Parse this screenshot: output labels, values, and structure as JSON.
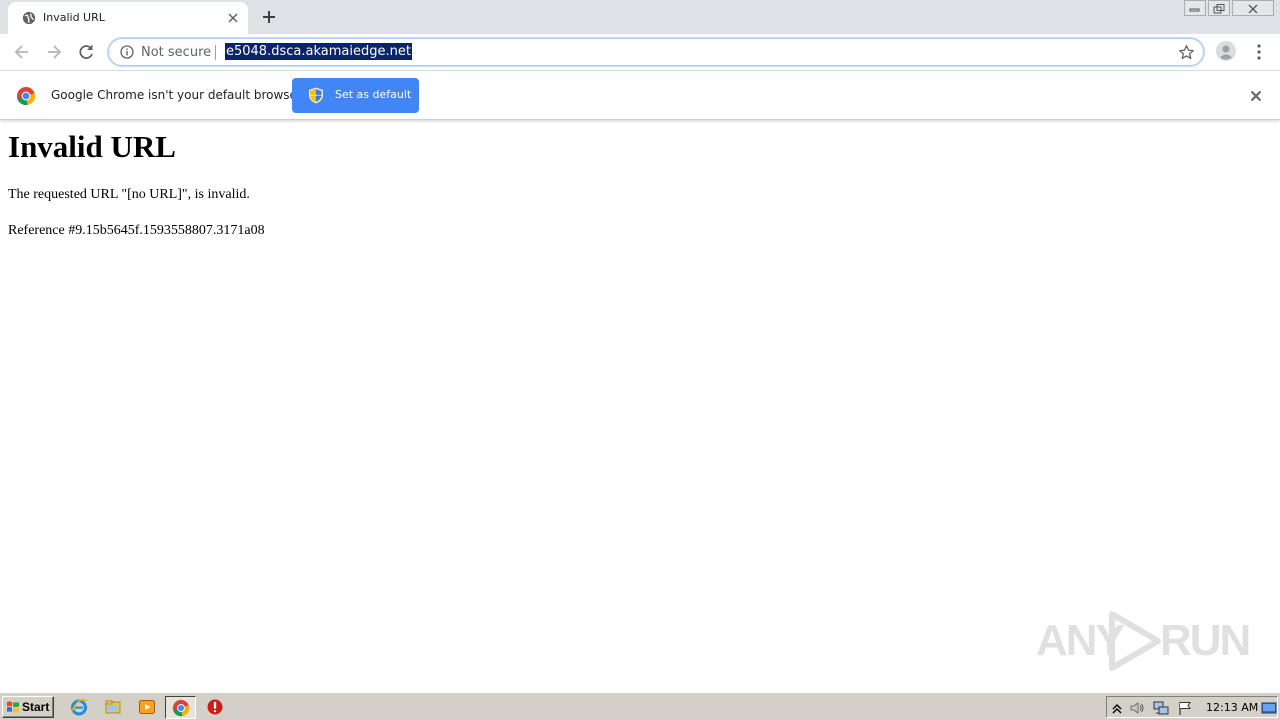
{
  "browser": {
    "tab": {
      "title": "Invalid URL",
      "favicon": "globe-icon",
      "close_icon": "close-icon"
    },
    "new_tab_icon": "plus-icon",
    "window_controls": [
      "minimize-icon",
      "restore-icon",
      "close-icon"
    ],
    "toolbar": {
      "back_icon": "arrow-left-icon",
      "forward_icon": "arrow-right-icon",
      "reload_icon": "reload-icon",
      "omnibox": {
        "security_label": "Not secure",
        "url": "e5048.dsca.akamaiedge.net",
        "url_selected": true
      },
      "bookmark_icon": "star-icon",
      "profile_icon": "avatar-icon",
      "menu_icon": "kebab-menu-icon"
    },
    "infobar": {
      "message": "Google Chrome isn't your default browser",
      "button_label": "Set as default",
      "button_color": "#4285f4"
    }
  },
  "page": {
    "heading": "Invalid URL",
    "message": "The requested URL \"[no URL]\", is invalid.",
    "reference": "Reference #9.15b5645f.1593558807.3171a08"
  },
  "watermark": {
    "left": "ANY",
    "right": "RUN"
  },
  "taskbar": {
    "start_label": "Start",
    "pinned": [
      "internet-explorer-icon",
      "folder-icon",
      "media-player-icon",
      "chrome-icon",
      "stop-icon"
    ],
    "tray": {
      "icons": [
        "show-hidden-icon",
        "volume-icon",
        "network-icon",
        "flag-icon",
        "desktop-icon"
      ],
      "clock": "12:13 AM"
    }
  }
}
